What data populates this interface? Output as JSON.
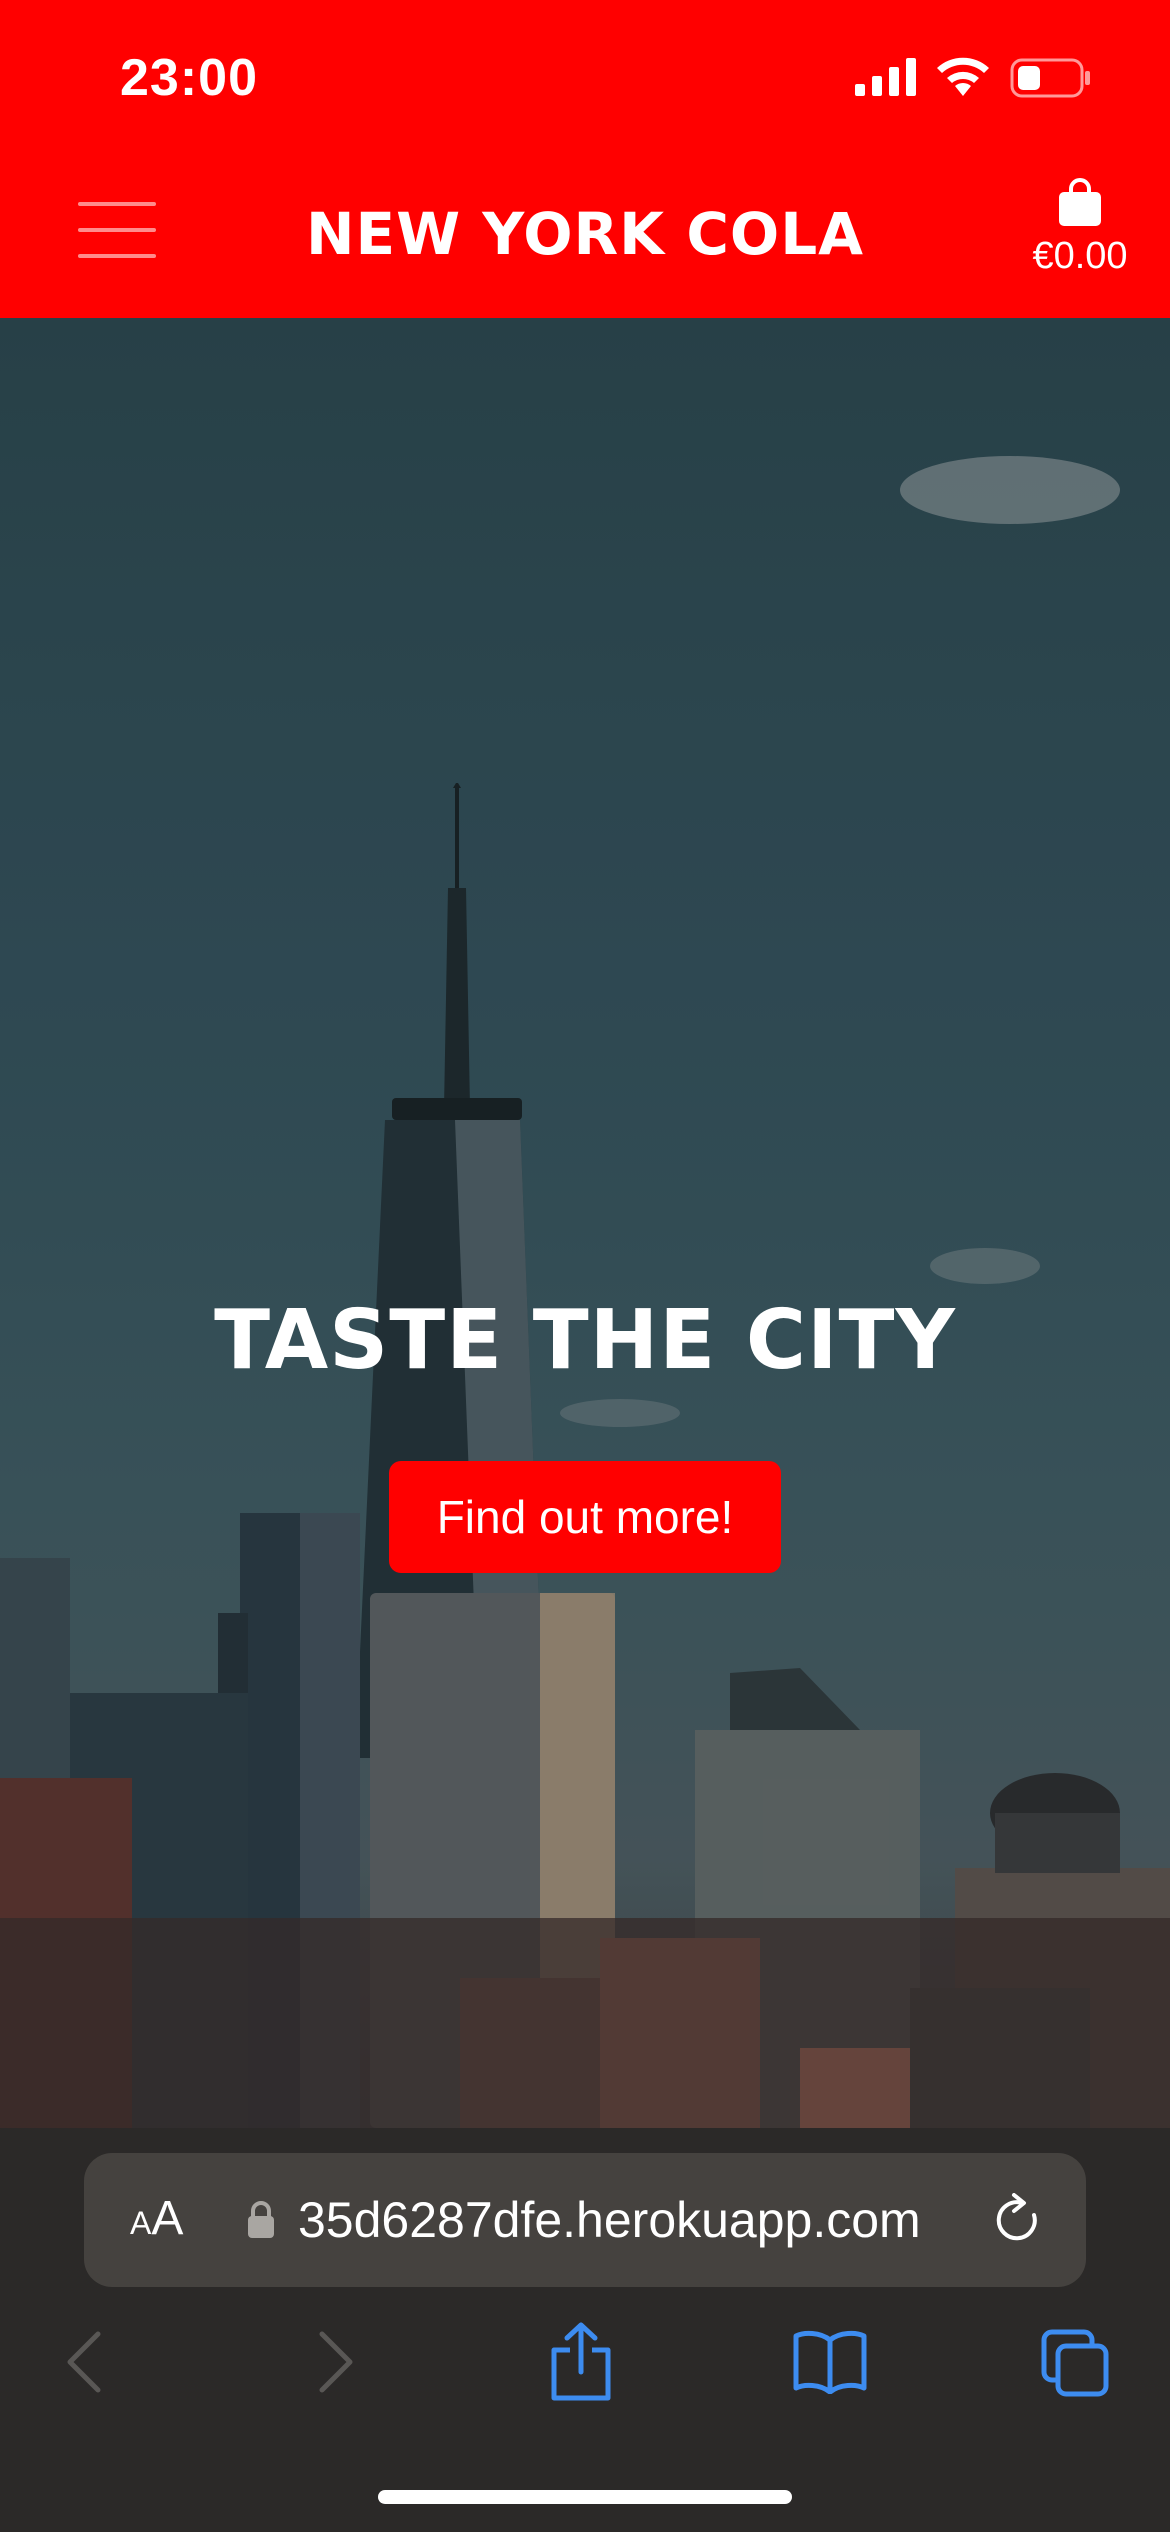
{
  "status_bar": {
    "time": "23:00"
  },
  "header": {
    "brand": "NEW YORK COLA",
    "cart_total": "€0.00"
  },
  "hero": {
    "title": "TASTE THE CITY",
    "cta_label": "Find out more!"
  },
  "browser": {
    "text_size_small": "A",
    "text_size_large": "A",
    "url": "35d6287dfe.herokuapp.com"
  },
  "colors": {
    "brand_red": "#ff0000",
    "safari_accent": "#3d8cf0"
  },
  "icons": [
    "hamburger-menu-icon",
    "shopping-bag-icon",
    "lock-icon",
    "reload-icon",
    "back-icon",
    "forward-icon",
    "share-icon",
    "bookmarks-icon",
    "tabs-icon"
  ]
}
